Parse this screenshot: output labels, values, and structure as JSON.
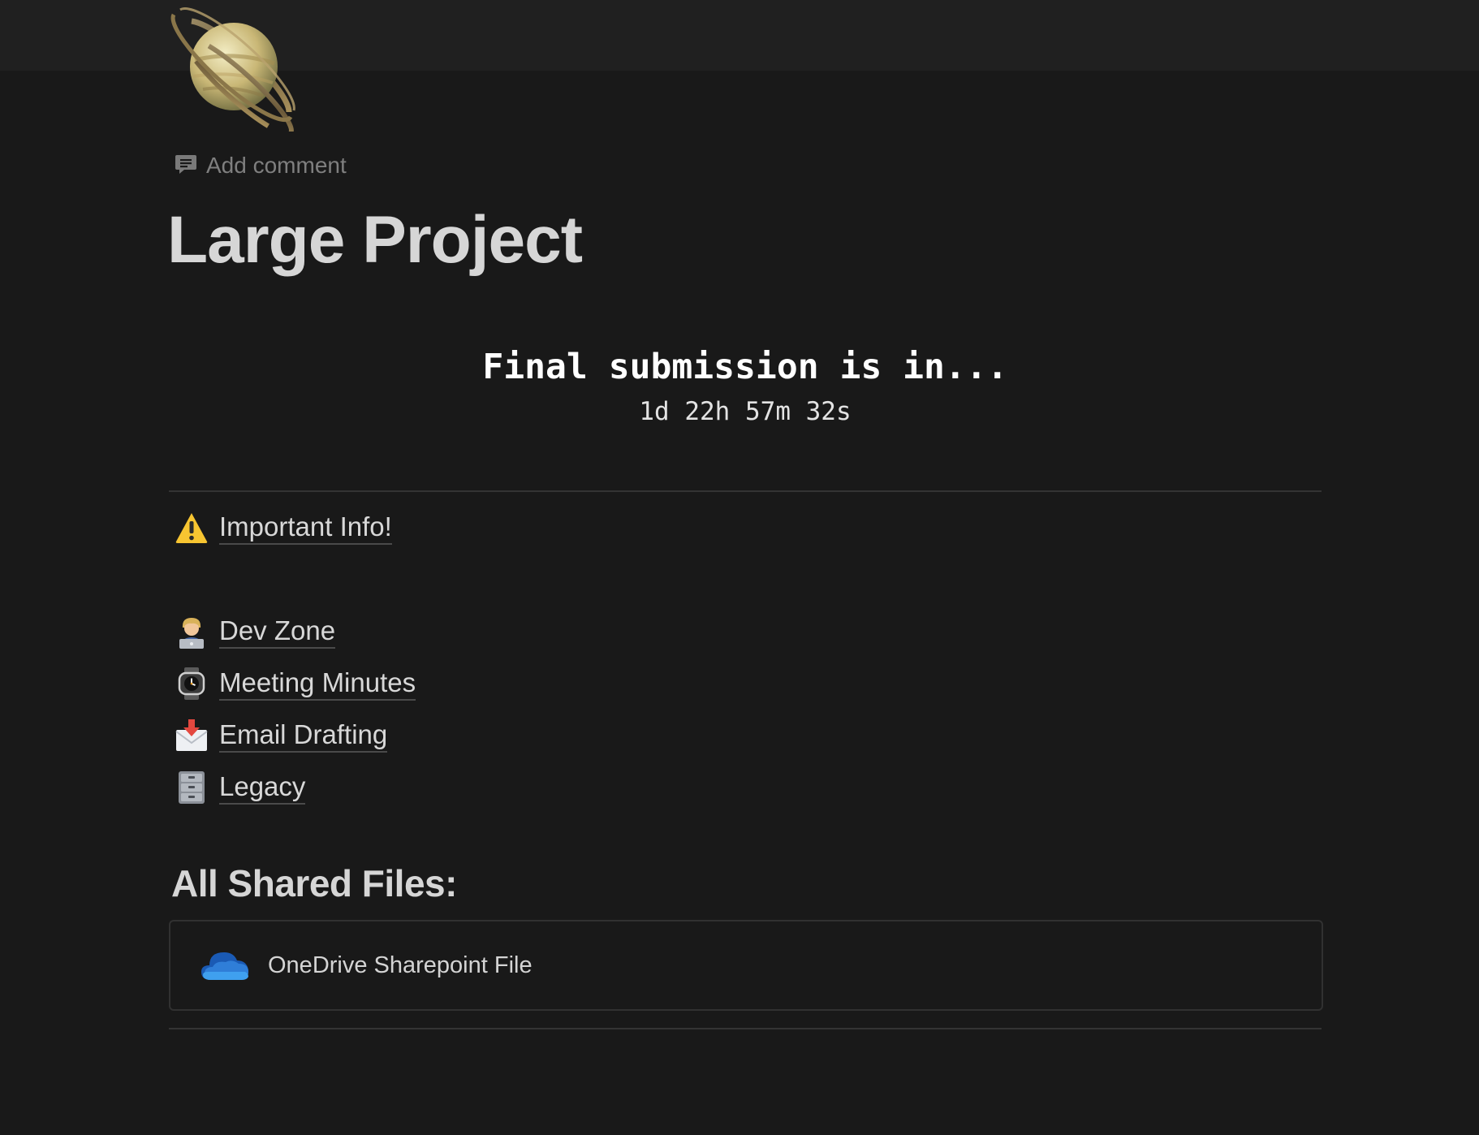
{
  "page": {
    "icon": "ringed-planet-icon",
    "add_comment": "Add comment",
    "title": "Large Project"
  },
  "countdown": {
    "headline": "Final submission is in...",
    "time": "1d 22h 57m 32s"
  },
  "links": [
    {
      "icon": "warning-icon",
      "label": "Important Info!"
    },
    {
      "icon": "technologist-icon",
      "label": "Dev Zone"
    },
    {
      "icon": "wristwatch-icon",
      "label": "Meeting Minutes"
    },
    {
      "icon": "envelope-with-arrow-icon",
      "label": "Email Drafting"
    },
    {
      "icon": "file-cabinet-icon",
      "label": "Legacy"
    }
  ],
  "shared_files": {
    "heading": "All Shared Files:",
    "files": [
      {
        "icon": "onedrive-cloud-icon",
        "name": "OneDrive Sharepoint File"
      }
    ]
  },
  "colors": {
    "background": "#191919",
    "cover": "#202020",
    "text": "#d6d6d6",
    "muted": "#7f7f7f",
    "onedrive_blue": "#2f7ed8"
  }
}
